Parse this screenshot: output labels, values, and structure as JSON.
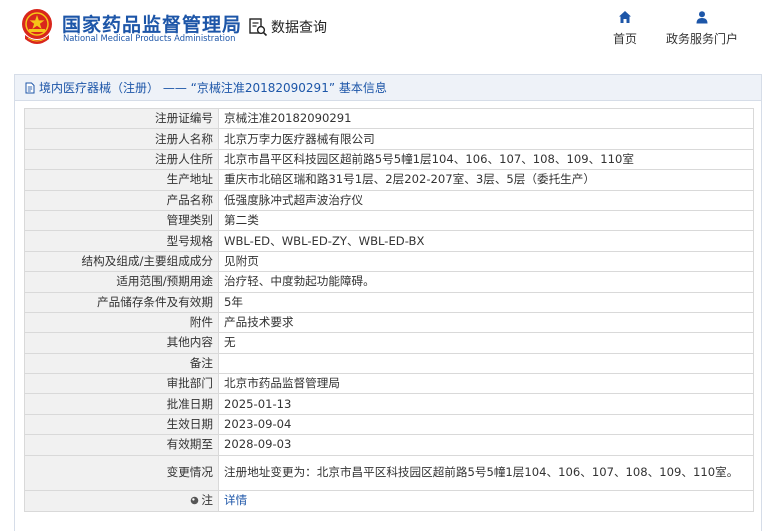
{
  "header": {
    "brand_cn": "国家药品监督管理局",
    "brand_en": "National Medical Products Administration",
    "query_label": "数据查询",
    "nav": [
      {
        "label": "首页",
        "icon": "home-icon"
      },
      {
        "label": "政务服务门户",
        "icon": "user-icon"
      }
    ]
  },
  "panel": {
    "title": "境内医疗器械（注册） ——  “京械注准20182090291” 基本信息"
  },
  "rows": [
    {
      "label": "注册证编号",
      "value": "京械注准20182090291"
    },
    {
      "label": "注册人名称",
      "value": "北京万孛力医疗器械有限公司"
    },
    {
      "label": "注册人住所",
      "value": "北京市昌平区科技园区超前路5号5幢1层104、106、107、108、109、110室"
    },
    {
      "label": "生产地址",
      "value": "重庆市北碚区瑞和路31号1层、2层202-207室、3层、5层（委托生产）"
    },
    {
      "label": "产品名称",
      "value": "低强度脉冲式超声波治疗仪"
    },
    {
      "label": "管理类别",
      "value": "第二类"
    },
    {
      "label": "型号规格",
      "value": "WBL-ED、WBL-ED-ZY、WBL-ED-BX"
    },
    {
      "label": "结构及组成/主要组成成分",
      "value": "见附页"
    },
    {
      "label": "适用范围/预期用途",
      "value": "治疗轻、中度勃起功能障碍。"
    },
    {
      "label": "产品储存条件及有效期",
      "value": "5年"
    },
    {
      "label": "附件",
      "value": "产品技术要求"
    },
    {
      "label": "其他内容",
      "value": "无"
    },
    {
      "label": "备注",
      "value": ""
    },
    {
      "label": "审批部门",
      "value": "北京市药品监督管理局"
    },
    {
      "label": "批准日期",
      "value": "2025-01-13"
    },
    {
      "label": "生效日期",
      "value": "2023-09-04"
    },
    {
      "label": "有效期至",
      "value": "2028-09-03"
    },
    {
      "label": "变更情况",
      "value": "注册地址变更为：北京市昌平区科技园区超前路5号5幢1层104、106、107、108、109、110室。"
    }
  ],
  "note_row": {
    "label": "注",
    "link": "详情"
  },
  "colors": {
    "brand_blue": "#1d56a8",
    "label_bg": "#f1f1f1",
    "head_bg": "#eef2f8"
  }
}
